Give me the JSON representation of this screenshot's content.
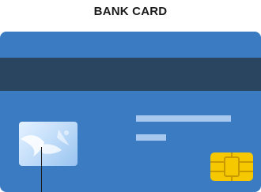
{
  "title": "BANK CARD",
  "colors": {
    "card_body": "#3a7bc2",
    "magnetic_stripe": "#2a4560",
    "signature_lines": "#a9c8f0",
    "chip": "#f5c800",
    "hologram": "#c5dffa"
  },
  "icons": {
    "hologram": "bird-hologram-icon",
    "chip": "emv-chip-icon"
  }
}
